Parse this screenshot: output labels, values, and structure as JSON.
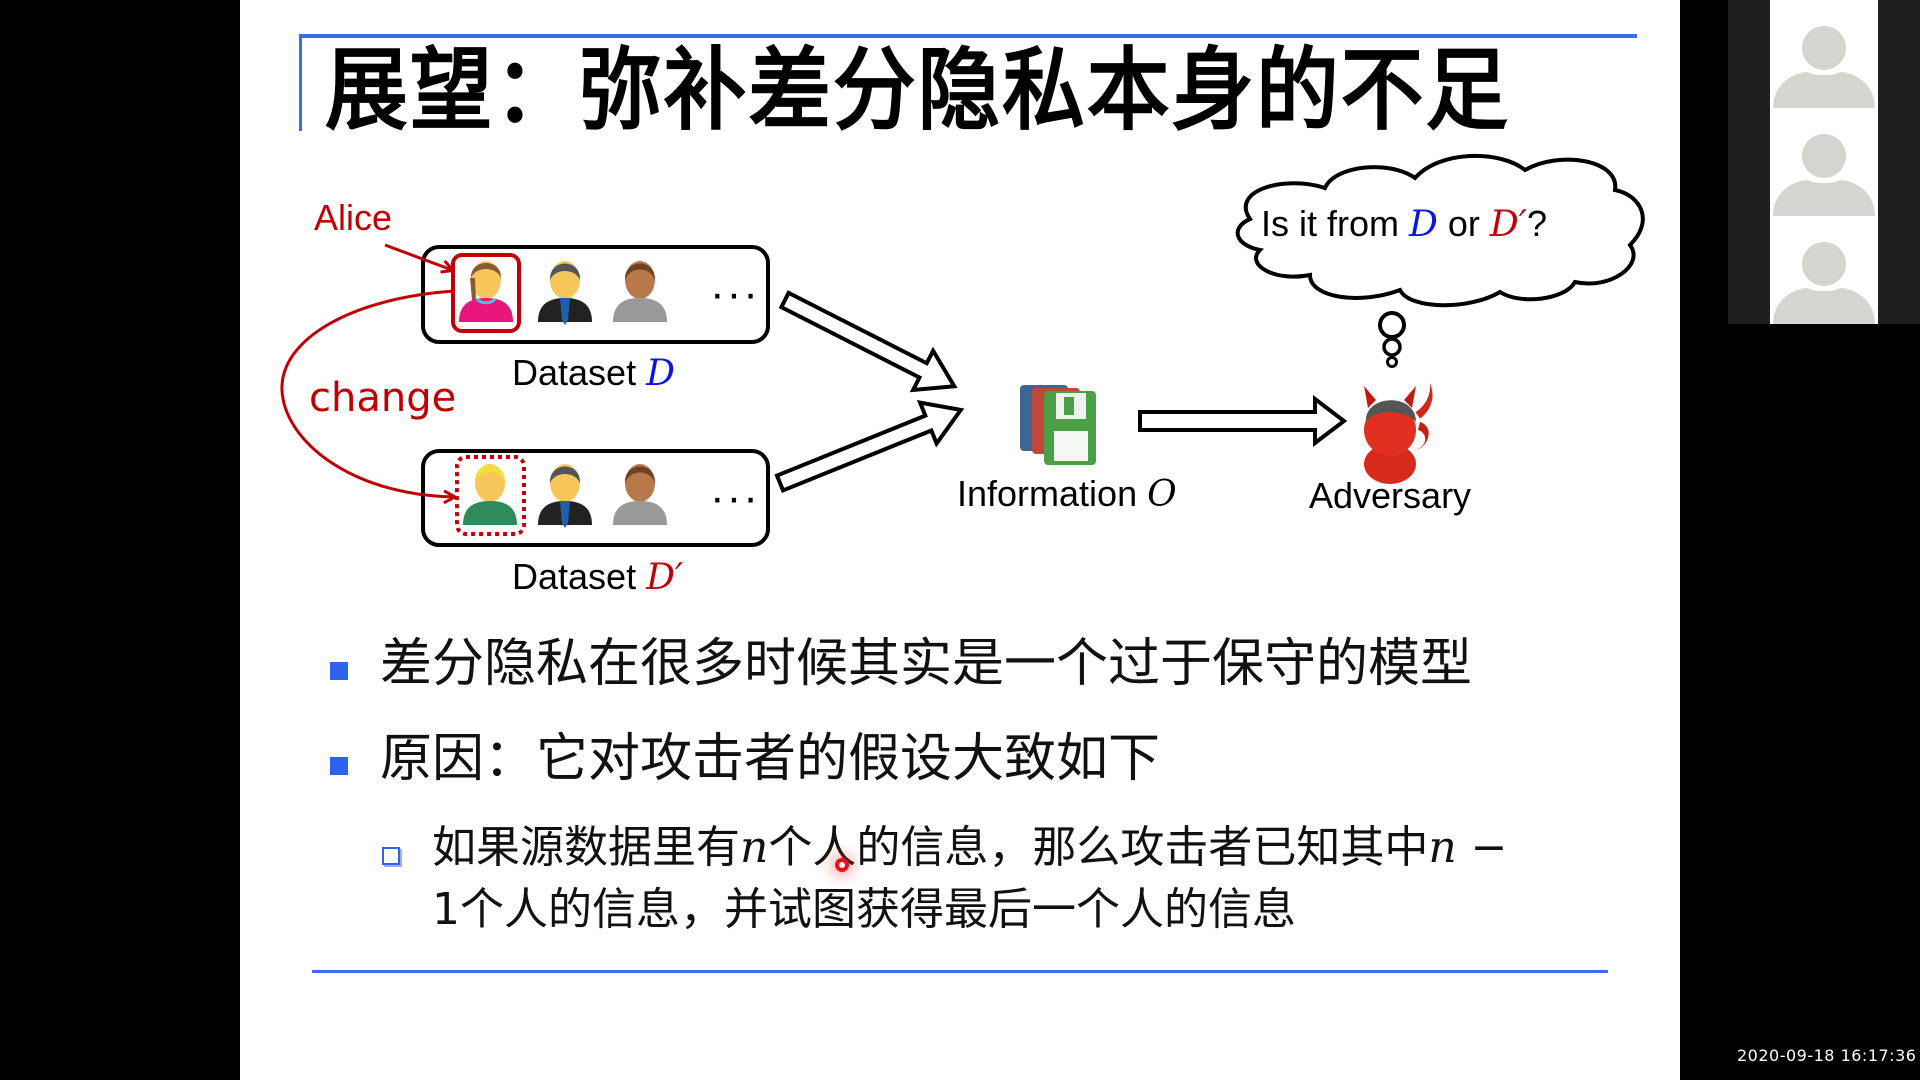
{
  "slide": {
    "title": "展望：弥补差分隐私本身的不足",
    "diagram": {
      "alice_label": "Alice",
      "change_label": "change",
      "dataset_d": {
        "prefix": "Dataset ",
        "symbol": "D"
      },
      "dataset_d_prime": {
        "prefix": "Dataset ",
        "symbol": "D′"
      },
      "ellipsis": "···",
      "information": {
        "prefix": "Information ",
        "symbol": "O"
      },
      "adversary_label": "Adversary",
      "thought": {
        "part1": "Is it from ",
        "sym1": "D",
        "part2": " or ",
        "sym2": "D′",
        "part3": "?"
      },
      "colors": {
        "d_symbol": "#0a14e6",
        "d_prime_symbol": "#c0000b",
        "annotation": "#c00000"
      }
    },
    "bullets": [
      {
        "level": 1,
        "text": "差分隐私在很多时候其实是一个过于保守的模型"
      },
      {
        "level": 1,
        "text": "原因：它对攻击者的假设大致如下"
      },
      {
        "level": 2,
        "line1_a": "如果源数据里有",
        "line1_n": "n",
        "line1_b": "个人的信息，那么攻击者已知其中",
        "line1_n2": "n",
        "line1_minus": " −",
        "line2": "1个人的信息，并试图获得最后一个人的信息"
      }
    ],
    "accent_color": "#3a6ee8"
  },
  "participants_panel": {
    "avatars": [
      "participant-1",
      "participant-2",
      "participant-3"
    ]
  },
  "timestamp": "2020-09-18  16:17:36"
}
